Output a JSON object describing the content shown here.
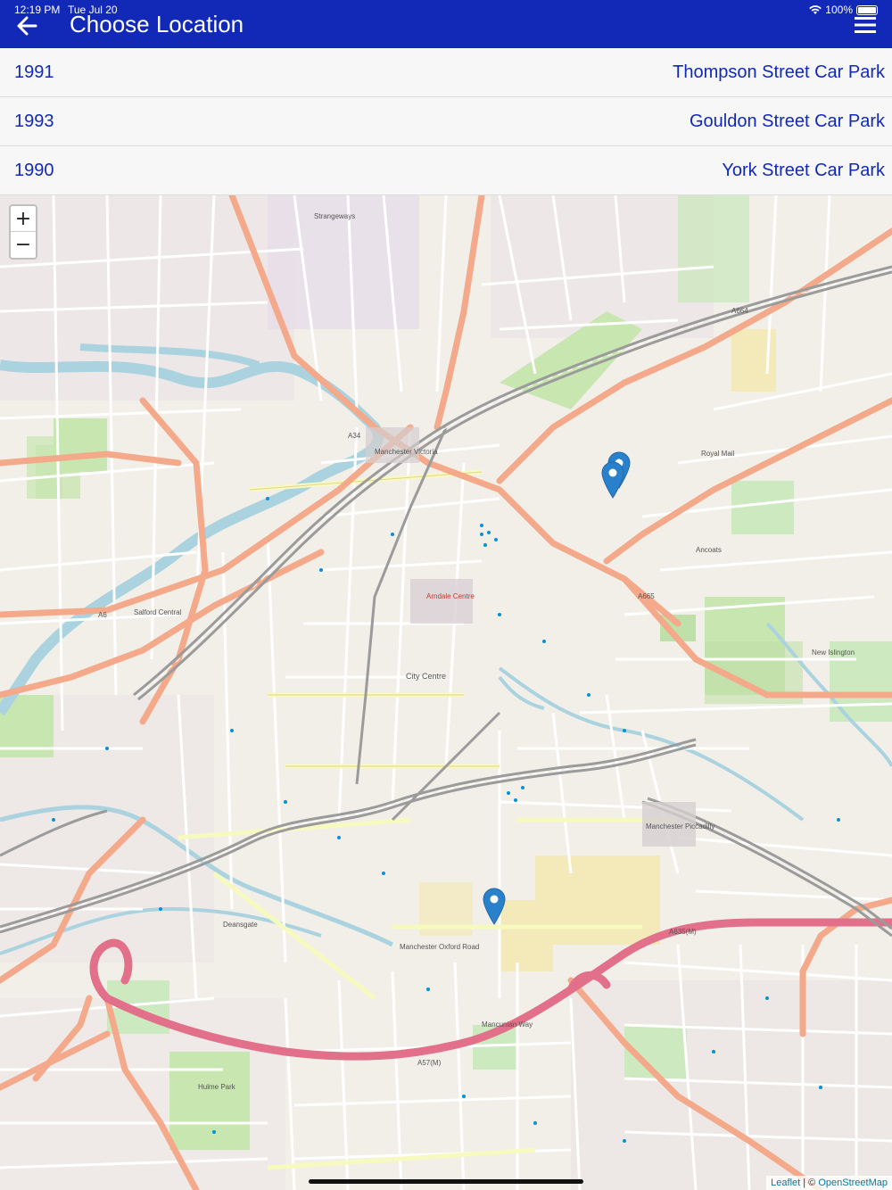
{
  "status": {
    "time": "12:19 PM",
    "date": "Tue Jul 20",
    "battery": "100%"
  },
  "header": {
    "title": "Choose Location",
    "back_icon": "arrow-left-icon",
    "menu_icon": "hamburger-menu-icon"
  },
  "locations": [
    {
      "code": "1991",
      "name": "Thompson Street Car Park"
    },
    {
      "code": "1993",
      "name": "Gouldon Street Car Park"
    },
    {
      "code": "1990",
      "name": "York Street Car Park"
    }
  ],
  "map": {
    "zoom_in": "+",
    "zoom_out": "−",
    "attribution_link1": "Leaflet",
    "attribution_sep": " | © ",
    "attribution_link2": "OpenStreetMap",
    "labels": {
      "strangeways": "Strangeways",
      "victoria": "Manchester Victoria",
      "arndale": "Arndale Centre",
      "city_centre": "City Centre",
      "piccadilly": "Manchester Piccadilly",
      "oxford_road": "Manchester Oxford Road",
      "ancoats": "Ancoats",
      "salford": "Salford Central",
      "deansgate": "Deansgate",
      "mancunian_way": "Mancunian Way",
      "a635m": "A635(M)",
      "a6": "A6",
      "a34": "A34",
      "a664": "A664",
      "a665": "A665",
      "a57m": "A57(M)",
      "hulme_park": "Hulme Park",
      "royal_mail": "Royal Mail",
      "new_islington": "New Islington"
    },
    "colors": {
      "marker": "#2a81cb",
      "primary_road": "#f3a98a",
      "motorway": "#e2708a",
      "rail": "#9b9b9b",
      "water": "#aad3df",
      "park": "#c8e6b0"
    }
  }
}
